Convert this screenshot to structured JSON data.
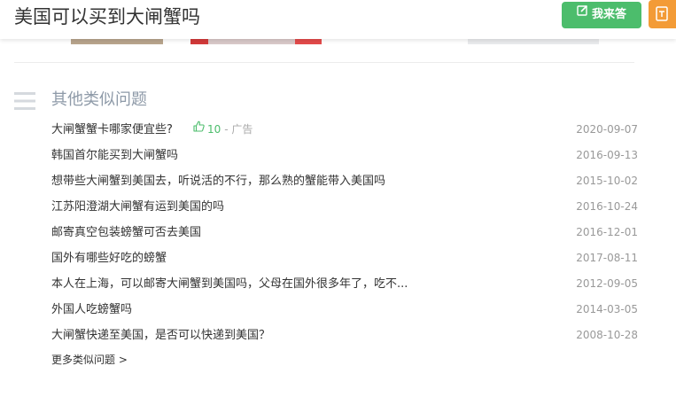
{
  "header": {
    "title": "美国可以买到大闸蟹吗",
    "answer_button": "我来答",
    "answer_icon": "edit-icon",
    "side_icon": "feedback-icon",
    "answer_color": "#4cbd6c",
    "side_color": "#f39b36"
  },
  "similar": {
    "title": "其他类似问题",
    "items": [
      {
        "text": "大闸蟹蟹卡哪家便宜些?",
        "date": "2020-09-07"
      },
      {
        "text": "韩国首尔能买到大闸蟹吗",
        "date": "2016-09-13"
      },
      {
        "text": "想带些大闸蟹到美国去，听说活的不行，那么熟的蟹能带入美国吗",
        "date": "2015-10-02"
      },
      {
        "text": "江苏阳澄湖大闸蟹有运到美国的吗",
        "date": "2016-10-24"
      },
      {
        "text": "邮寄真空包装螃蟹可否去美国",
        "date": "2016-12-01"
      },
      {
        "text": "国外有哪些好吃的螃蟹",
        "date": "2017-08-11"
      },
      {
        "text": "本人在上海，可以邮寄大闸蟹到美国吗，父母在国外很多年了，吃不...",
        "date": "2012-09-05"
      },
      {
        "text": "外国人吃螃蟹吗",
        "date": "2014-03-05"
      },
      {
        "text": "大闸蟹快递至美国，是否可以快递到美国？",
        "date": "2008-10-28"
      }
    ],
    "ad": {
      "likes": "10",
      "tag": "- 广告"
    },
    "more": "更多类似问题 >"
  }
}
